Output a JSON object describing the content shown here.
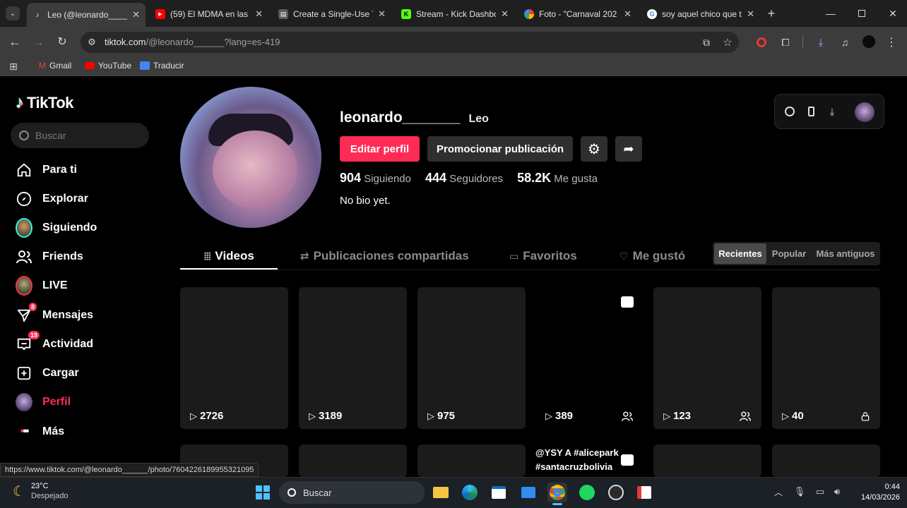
{
  "browser": {
    "tabs": [
      {
        "title": "Leo (@leonardo____",
        "active": true
      },
      {
        "title": "(59) El MDMA en las "
      },
      {
        "title": "Create a Single-Use T"
      },
      {
        "title": "Stream - Kick Dashbo"
      },
      {
        "title": "Foto - \"Carnaval 202"
      },
      {
        "title": "soy aquel chico que t"
      }
    ],
    "url_host": "tiktok.com",
    "url_path": "/@leonardo______?lang=es-419",
    "bookmarks": [
      "Gmail",
      "YouTube",
      "Traducir"
    ],
    "status_url": "https://www.tiktok.com/@leonardo______/photo/7604226189955321095"
  },
  "tiktok": {
    "logo": "TikTok",
    "search_placeholder": "Buscar",
    "nav": [
      {
        "label": "Para ti",
        "icon": "home-icon"
      },
      {
        "label": "Explorar",
        "icon": "compass-icon"
      },
      {
        "label": "Siguiendo",
        "icon": "following-avatar-icon"
      },
      {
        "label": "Friends",
        "icon": "friends-icon"
      },
      {
        "label": "LIVE",
        "icon": "live-icon"
      },
      {
        "label": "Mensajes",
        "icon": "messages-icon",
        "badge": "8"
      },
      {
        "label": "Actividad",
        "icon": "activity-icon",
        "badge": "19"
      },
      {
        "label": "Cargar",
        "icon": "upload-icon"
      },
      {
        "label": "Perfil",
        "icon": "profile-avatar-icon",
        "accent": true
      },
      {
        "label": "Más",
        "icon": "more-icon"
      }
    ],
    "profile": {
      "username": "leonardo_______",
      "nickname": "Leo",
      "edit_label": "Editar perfil",
      "promote_label": "Promocionar publicación",
      "stats": [
        {
          "value": "904",
          "label": "Siguiendo"
        },
        {
          "value": "444",
          "label": "Seguidores"
        },
        {
          "value": "58.2K",
          "label": "Me gusta"
        }
      ],
      "bio": "No bio yet."
    },
    "content_tabs": [
      "Videos",
      "Publicaciones compartidas",
      "Favoritos",
      "Me gustó"
    ],
    "sort_options": [
      "Recientes",
      "Popular",
      "Más antiguos"
    ],
    "videos": [
      {
        "views": "2726",
        "corner": ""
      },
      {
        "views": "3189",
        "corner": ""
      },
      {
        "views": "975",
        "corner": ""
      },
      {
        "views": "389",
        "corner": "friends-icon",
        "photo": true
      },
      {
        "views": "123",
        "corner": "friends-icon"
      },
      {
        "views": "40",
        "corner": "lock-icon"
      }
    ],
    "caption_preview": [
      "@YSY A #alicepark",
      "#santacruzbolivia"
    ],
    "accent_color": "#fe2c55"
  },
  "taskbar": {
    "weather_temp": "23°C",
    "weather_desc": "Despejado",
    "search_placeholder": "Buscar",
    "time": "0:44",
    "date": "14/03/2026"
  }
}
